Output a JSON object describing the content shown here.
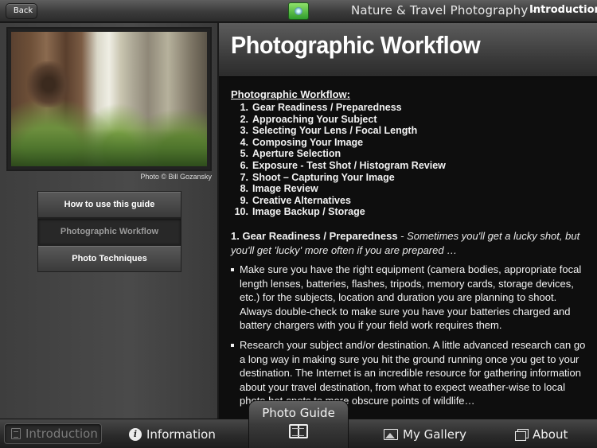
{
  "topbar": {
    "back_label": "Back",
    "logo_icon": "app-logo-icon",
    "app_title": "Nature & Travel Photography -",
    "section": "Introduction"
  },
  "sidebar": {
    "photo_credit": "Photo © Bill Gozansky",
    "nav": [
      {
        "label": "How to use this guide",
        "active": false
      },
      {
        "label": "Photographic Workflow",
        "active": true
      },
      {
        "label": "Photo Techniques",
        "active": false
      }
    ]
  },
  "content": {
    "title": "Photographic Workflow",
    "toc_heading": "Photographic Workflow:",
    "toc": [
      {
        "num": "1.",
        "text": "Gear Readiness / Preparedness"
      },
      {
        "num": "2.",
        "text": "Approaching Your Subject"
      },
      {
        "num": "3.",
        "text": "Selecting Your Lens / Focal Length"
      },
      {
        "num": "4.",
        "text": "Composing Your Image"
      },
      {
        "num": "5.",
        "text": "Aperture Selection"
      },
      {
        "num": "6.",
        "text": "Exposure - Test Shot / Histogram Review"
      },
      {
        "num": "7.",
        "text": "Shoot – Capturing Your Image"
      },
      {
        "num": "8.",
        "text": "Image Review"
      },
      {
        "num": "9.",
        "text": "Creative Alternatives"
      },
      {
        "num": "10.",
        "text": "Image Backup / Storage"
      }
    ],
    "section1_heading": "1. Gear Readiness / Preparedness",
    "section1_intro": " - Sometimes you'll get a lucky shot, but you'll get 'lucky' more often if you are prepared …",
    "bullets": [
      "Make sure you have the right equipment (camera bodies, appropriate focal length lenses, batteries, flashes, tripods, memory cards, storage devices, etc.) for the subjects, location and duration you are planning to shoot. Always double-check to make sure you have your batteries charged and battery chargers with you if your field work requires them.",
      "Research your subject and/or destination. A little advanced research can go a long way in making sure you hit the ground running once you get to your destination. The Internet is an incredible resource for gathering information about your travel destination, from what to expect weather-wise to local photo hot-spots to more obscure points of wildlife…"
    ]
  },
  "tabbar": {
    "tabs": [
      {
        "label": "Introduction",
        "icon": "document-icon"
      },
      {
        "label": "Information",
        "icon": "info-icon"
      },
      {
        "label": "Photo Guide",
        "icon": "book-icon"
      },
      {
        "label": "My Gallery",
        "icon": "gallery-icon"
      },
      {
        "label": "About",
        "icon": "about-icon"
      }
    ]
  }
}
